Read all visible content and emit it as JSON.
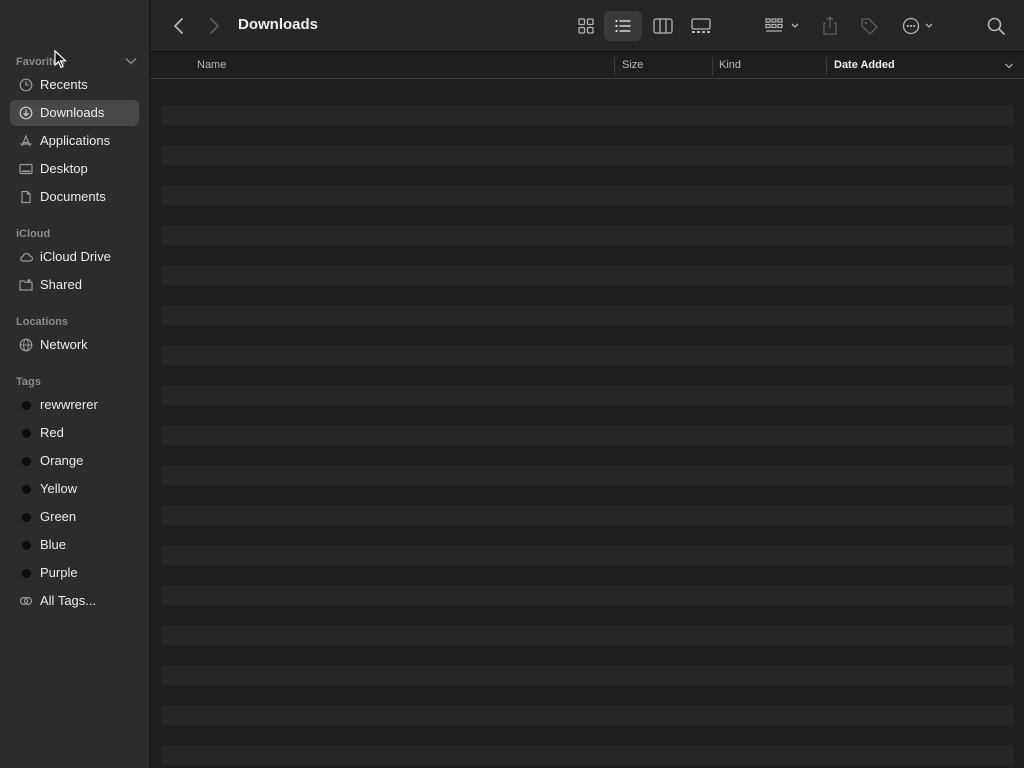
{
  "sidebar": {
    "favorites": {
      "header": "Favorites",
      "items": [
        {
          "label": "Recents",
          "icon": "clock-icon"
        },
        {
          "label": "Downloads",
          "icon": "download-circle-icon",
          "selected": true
        },
        {
          "label": "Applications",
          "icon": "applications-icon"
        },
        {
          "label": "Desktop",
          "icon": "desktop-icon"
        },
        {
          "label": "Documents",
          "icon": "document-icon"
        }
      ]
    },
    "icloud": {
      "header": "iCloud",
      "items": [
        {
          "label": "iCloud Drive",
          "icon": "cloud-icon"
        },
        {
          "label": "Shared",
          "icon": "shared-folder-icon"
        }
      ]
    },
    "locations": {
      "header": "Locations",
      "items": [
        {
          "label": "Network",
          "icon": "globe-icon"
        }
      ]
    },
    "tags": {
      "header": "Tags",
      "items": [
        {
          "label": "rewwrerer"
        },
        {
          "label": "Red"
        },
        {
          "label": "Orange"
        },
        {
          "label": "Yellow"
        },
        {
          "label": "Green"
        },
        {
          "label": "Blue"
        },
        {
          "label": "Purple"
        },
        {
          "label": "All Tags..."
        }
      ]
    }
  },
  "toolbar": {
    "title": "Downloads"
  },
  "columns": {
    "name": "Name",
    "size": "Size",
    "kind": "Kind",
    "date_added": "Date Added"
  },
  "colors": {
    "sidebar_bg": "#2c2c2e",
    "main_bg": "#1e1e1e",
    "selection": "#48484a",
    "stripe": "#262626"
  }
}
